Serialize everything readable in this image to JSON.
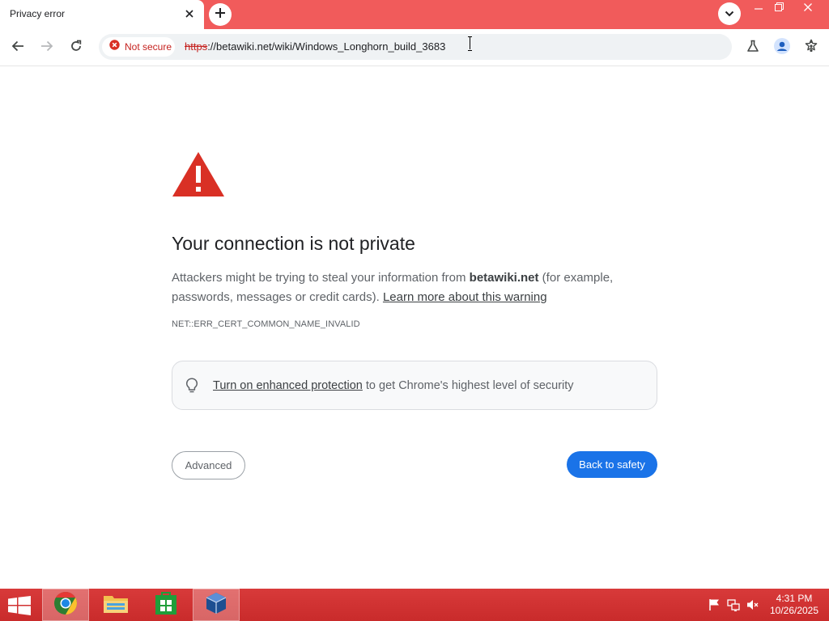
{
  "browser": {
    "tab": {
      "title": "Privacy error"
    },
    "toolbar": {
      "security_chip": "Not secure",
      "url_scheme": "https",
      "url_rest": "://betawiki.net/wiki/Windows_Longhorn_build_3683"
    }
  },
  "page": {
    "heading": "Your connection is not private",
    "explain_prefix": "Attackers might be trying to steal your information from ",
    "explain_domain": "betawiki.net",
    "explain_middle": " (for example, passwords, messages or credit cards). ",
    "learn_more_link": "Learn more about this warning",
    "error_code": "NET::ERR_CERT_COMMON_NAME_INVALID",
    "enhanced_link": "Turn on enhanced protection",
    "enhanced_rest": " to get Chrome's highest level of security",
    "advanced_button": "Advanced",
    "back_button": "Back to safety"
  },
  "taskbar": {
    "time": "4:31 PM",
    "date": "10/26/2025"
  },
  "colors": {
    "tabstrip": "#f15b5b",
    "warning_red": "#d93025",
    "primary_blue": "#1a73e8",
    "taskbar": "#d13333"
  },
  "icons": [
    "close-icon",
    "plus-icon",
    "chevron-down-icon",
    "minimize-icon",
    "restore-icon",
    "back-arrow-icon",
    "forward-arrow-icon",
    "reload-icon",
    "not-secure-icon",
    "star-icon",
    "labs-flask-icon",
    "profile-icon",
    "kebab-menu-icon",
    "warning-triangle-icon",
    "lightbulb-icon",
    "windows-start-icon",
    "chrome-icon",
    "file-explorer-icon",
    "store-icon",
    "virtualbox-icon",
    "flag-icon",
    "network-icon",
    "volume-muted-icon"
  ]
}
